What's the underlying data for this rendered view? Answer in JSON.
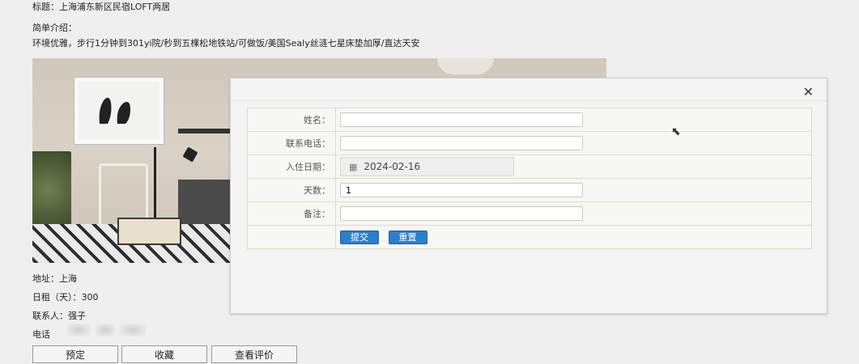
{
  "listing": {
    "title_line": "标题：上海浦东新区民宿LOFT两居",
    "intro_label": "简单介绍：",
    "intro_text": "环境优雅，步行1分钟到301yi院/秒到五棵松地铁站/可做饭/美国Sealy丝涟七星床垫加厚/直达天安",
    "address": "地址：上海",
    "rent": "日租（天）：300",
    "contact": "联系人：强子",
    "phone_label": "电话"
  },
  "actions": {
    "book": "预定",
    "favorite": "收藏",
    "reviews": "查看评价"
  },
  "dialog": {
    "close_icon": "close-icon",
    "fields": {
      "name_label": "姓名：",
      "name_value": "",
      "phone_label": "联系电话：",
      "phone_value": "",
      "checkin_label": "入住日期：",
      "checkin_value": "2024-02-16",
      "days_label": "天数：",
      "days_value": "1",
      "note_label": "备注：",
      "note_value": ""
    },
    "submit": "提交",
    "reset": "重置"
  },
  "colors": {
    "button_blue": "#2f7fc8",
    "background": "#efefef"
  }
}
